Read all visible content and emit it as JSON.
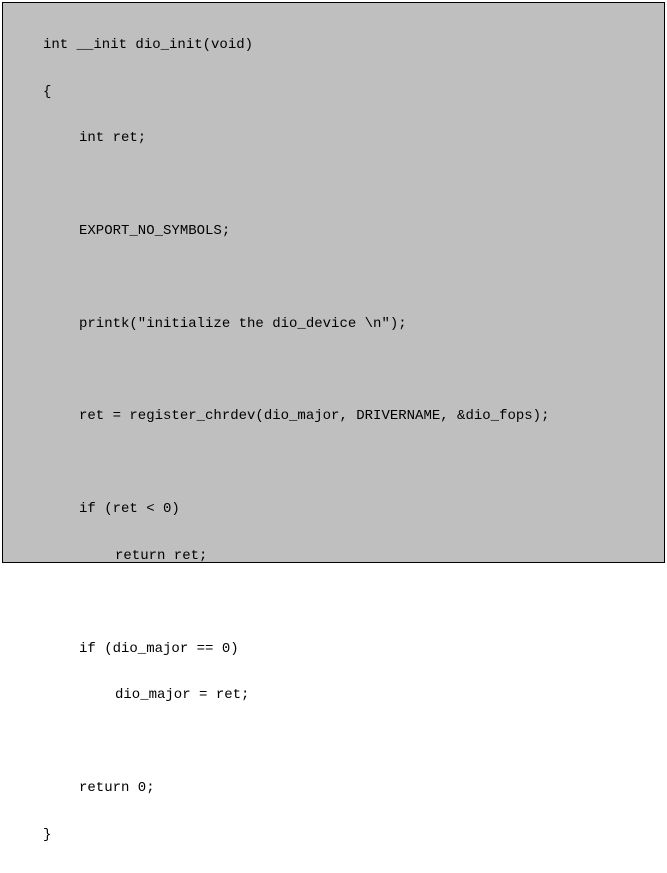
{
  "code": {
    "l1": "int __init dio_init(void)",
    "l2": "{",
    "l3": "int ret;",
    "l4": "EXPORT_NO_SYMBOLS;",
    "l5": "printk(\"initialize the dio_device \\n\");",
    "l6": "ret = register_chrdev(dio_major, DRIVERNAME, &dio_fops);",
    "l7": "if (ret < 0)",
    "l8": "return ret;",
    "l9": "if (dio_major == 0)",
    "l10": "dio_major = ret;",
    "l11": "return 0;",
    "l12": "}"
  }
}
